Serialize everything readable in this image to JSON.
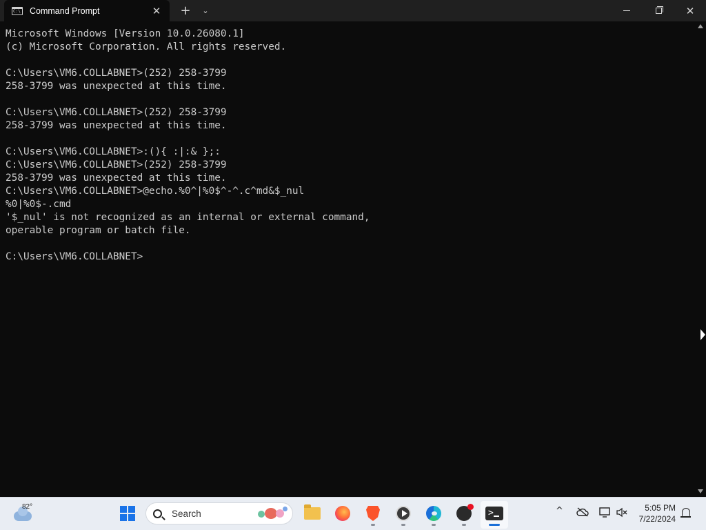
{
  "window": {
    "tab_title": "Command Prompt",
    "tab_icon_text": "C:\\",
    "new_tab_symbol": "+",
    "dropdown_symbol": "⌄",
    "close_tab_symbol": "✕",
    "close_window_symbol": "✕"
  },
  "console": {
    "text": "Microsoft Windows [Version 10.0.26080.1]\n(c) Microsoft Corporation. All rights reserved.\n\nC:\\Users\\VM6.COLLABNET>(252) 258-3799\n258-3799 was unexpected at this time.\n\nC:\\Users\\VM6.COLLABNET>(252) 258-3799\n258-3799 was unexpected at this time.\n\nC:\\Users\\VM6.COLLABNET>:(){ :|:& };:\nC:\\Users\\VM6.COLLABNET>(252) 258-3799\n258-3799 was unexpected at this time.\nC:\\Users\\VM6.COLLABNET>@echo.%0^|%0$^-^.c^md&$_nul\n%0|%0$-.cmd\n'$_nul' is not recognized as an internal or external command,\noperable program or batch file.\n\nC:\\Users\\VM6.COLLABNET>"
  },
  "taskbar": {
    "weather_temp": "82°",
    "search_placeholder": "Search",
    "pinned": [
      "start-menu",
      "file-explorer",
      "firefox",
      "brave",
      "media-player",
      "edge",
      "obs-studio",
      "terminal"
    ],
    "tray_chevron": "^",
    "time": "5:05 PM",
    "date": "7/22/2024"
  },
  "colors": {
    "console_bg": "#0c0c0c",
    "console_fg": "#cccccc",
    "titlebar_bg": "#202020",
    "taskbar_bg": "#e9edf3",
    "accent": "#1a6fd8"
  }
}
